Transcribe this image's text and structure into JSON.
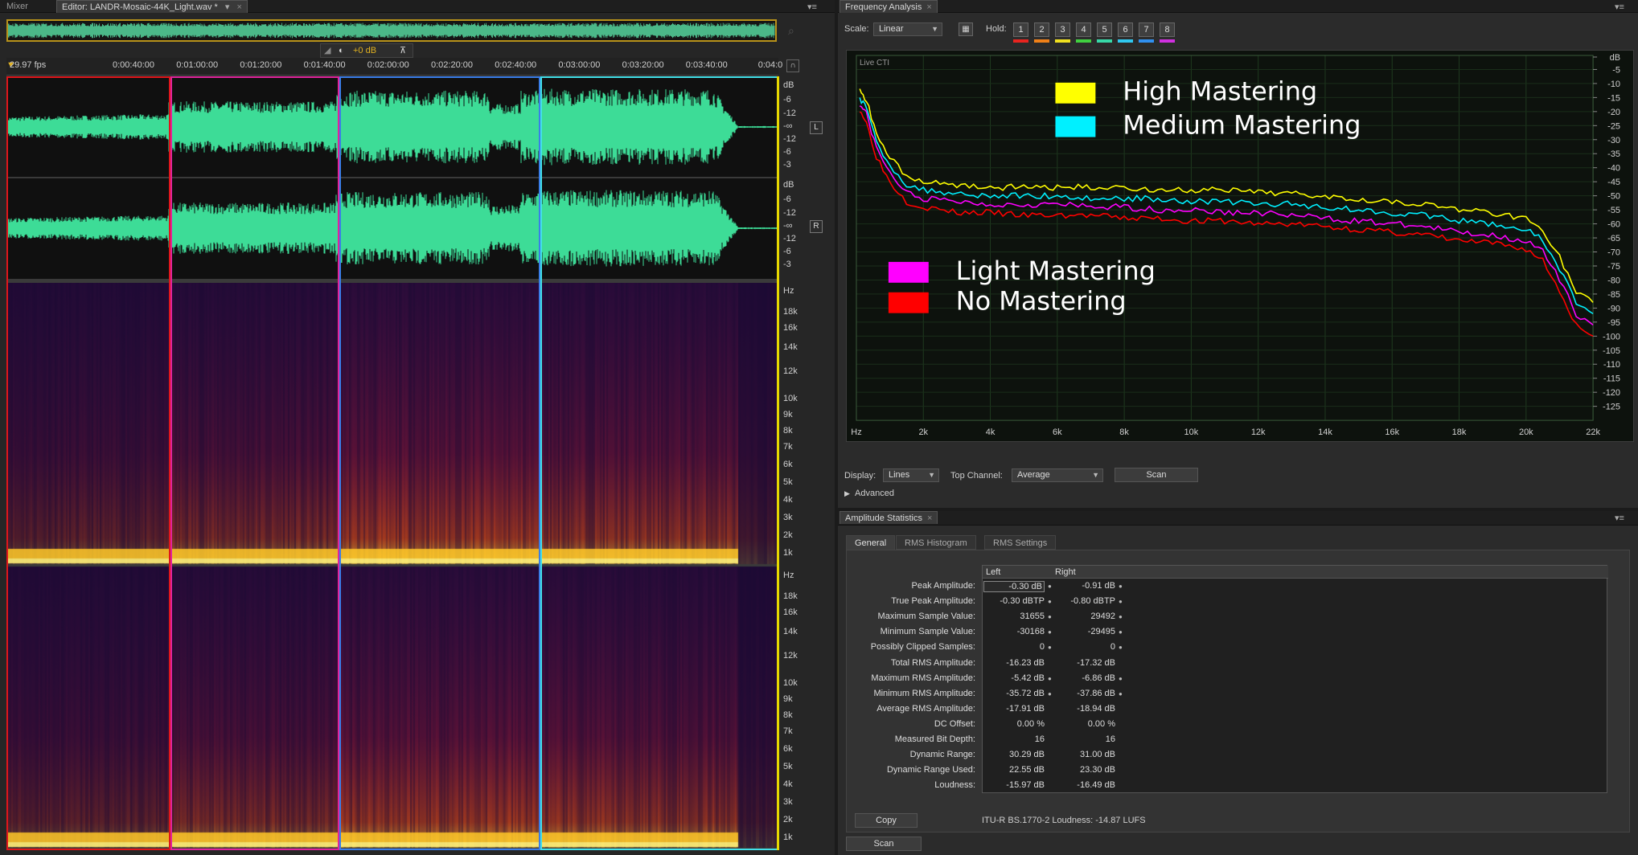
{
  "editor": {
    "tabs": [
      {
        "label": "Mixer"
      },
      {
        "label": "Editor: LANDR-Mosaic-44K_Light.wav *"
      }
    ],
    "fps_label": "29.97 fps",
    "hud_gain": "+0 dB",
    "timeline_ticks": [
      "0:00:40:00",
      "0:01:00:00",
      "0:01:20:00",
      "0:01:40:00",
      "0:02:00:00",
      "0:02:20:00",
      "0:02:40:00",
      "0:03:00:00",
      "0:03:20:00",
      "0:03:40:00",
      "0:04:0"
    ],
    "waveform_scale": [
      "dB",
      "-6",
      "-12",
      "-∞",
      "-12",
      "-6",
      "-3"
    ],
    "channels": [
      "L",
      "R"
    ],
    "spectral_scale": [
      "Hz",
      "18k",
      "16k",
      "14k",
      "12k",
      "10k",
      "9k",
      "8k",
      "7k",
      "6k",
      "5k",
      "4k",
      "3k",
      "2k",
      "1k"
    ],
    "selection_colors": {
      "red": "#e0161b",
      "magenta": "#e0249c",
      "blue": "#3a7de8",
      "cyan": "#42e0e8",
      "yellow": "#e8d800"
    },
    "waveform_color": "#3ddc97"
  },
  "frequency_analysis": {
    "title": "Frequency Analysis",
    "scale_label": "Scale:",
    "scale_value": "Linear",
    "hold_label": "Hold:",
    "hold_buttons": [
      {
        "label": "1",
        "color": "#e8241f"
      },
      {
        "label": "2",
        "color": "#f08018"
      },
      {
        "label": "3",
        "color": "#f0e020"
      },
      {
        "label": "4",
        "color": "#40d040"
      },
      {
        "label": "5",
        "color": "#38d8a8"
      },
      {
        "label": "6",
        "color": "#30c8f0"
      },
      {
        "label": "7",
        "color": "#3090f0"
      },
      {
        "label": "8",
        "color": "#d030e0"
      }
    ],
    "plot_tag": "Live CTI",
    "legend": [
      {
        "label": "High Mastering",
        "color": "#ffff00"
      },
      {
        "label": "Medium Mastering",
        "color": "#00f0ff"
      },
      {
        "label": "Light Mastering",
        "color": "#ff00ff"
      },
      {
        "label": "No Mastering",
        "color": "#ff0000"
      }
    ],
    "display_label": "Display:",
    "display_value": "Lines",
    "top_channel_label": "Top Channel:",
    "top_channel_value": "Average",
    "scan_label": "Scan",
    "advanced_label": "Advanced",
    "chart_data": {
      "type": "line",
      "xlabel": "Hz",
      "xlim": [
        0,
        22000
      ],
      "ylim": [
        -130,
        0
      ],
      "x_ticks": [
        "Hz",
        "2k",
        "4k",
        "6k",
        "8k",
        "10k",
        "12k",
        "14k",
        "16k",
        "18k",
        "20k",
        "22k"
      ],
      "y_ticks": [
        "dB",
        "-5",
        "-10",
        "-15",
        "-20",
        "-25",
        "-30",
        "-35",
        "-40",
        "-45",
        "-50",
        "-55",
        "-60",
        "-65",
        "-70",
        "-75",
        "-80",
        "-85",
        "-90",
        "-95",
        "-100",
        "-105",
        "-110",
        "-115",
        "-120",
        "-125"
      ],
      "x": [
        100,
        300,
        600,
        1000,
        1500,
        2000,
        3000,
        4000,
        5000,
        6000,
        7000,
        8000,
        9000,
        10000,
        11000,
        12000,
        13000,
        14000,
        15000,
        16000,
        17000,
        18000,
        19000,
        20000,
        20500,
        21000,
        21500,
        22000
      ],
      "series": [
        {
          "name": "High Mastering",
          "color": "#ffff00",
          "values": [
            -12,
            -16,
            -28,
            -36,
            -43,
            -45,
            -46,
            -47,
            -47,
            -47,
            -47,
            -47,
            -48,
            -48,
            -48,
            -49,
            -49,
            -50,
            -51,
            -52,
            -53,
            -55,
            -56,
            -58,
            -62,
            -72,
            -84,
            -88
          ]
        },
        {
          "name": "Medium Mastering",
          "color": "#00f0ff",
          "values": [
            -15,
            -19,
            -31,
            -39,
            -46,
            -48,
            -49,
            -50,
            -50,
            -50,
            -51,
            -51,
            -51,
            -52,
            -52,
            -53,
            -53,
            -54,
            -55,
            -56,
            -57,
            -59,
            -60,
            -62,
            -66,
            -76,
            -88,
            -92
          ]
        },
        {
          "name": "Light Mastering",
          "color": "#ff00ff",
          "values": [
            -17,
            -21,
            -33,
            -42,
            -49,
            -51,
            -52,
            -53,
            -53,
            -53,
            -54,
            -54,
            -55,
            -55,
            -56,
            -56,
            -57,
            -58,
            -59,
            -60,
            -61,
            -63,
            -64,
            -66,
            -70,
            -80,
            -92,
            -96
          ]
        },
        {
          "name": "No Mastering",
          "color": "#ff0000",
          "values": [
            -19,
            -24,
            -36,
            -45,
            -52,
            -54,
            -56,
            -56,
            -57,
            -57,
            -57,
            -58,
            -58,
            -59,
            -59,
            -60,
            -60,
            -61,
            -62,
            -63,
            -64,
            -66,
            -67,
            -69,
            -73,
            -84,
            -96,
            -100
          ]
        }
      ]
    }
  },
  "amplitude_statistics": {
    "title": "Amplitude Statistics",
    "tabs": [
      "General",
      "RMS Histogram",
      "RMS Settings"
    ],
    "columns": [
      "Left",
      "Right"
    ],
    "rows": [
      {
        "label": "Peak Amplitude:",
        "left": "-0.30 dB",
        "right": "-0.91 dB",
        "pin": true
      },
      {
        "label": "True Peak Amplitude:",
        "left": "-0.30 dBTP",
        "right": "-0.80 dBTP",
        "pin": true
      },
      {
        "label": "Maximum Sample Value:",
        "left": "31655",
        "right": "29492",
        "pin": true
      },
      {
        "label": "Minimum Sample Value:",
        "left": "-30168",
        "right": "-29495",
        "pin": true
      },
      {
        "label": "Possibly Clipped Samples:",
        "left": "0",
        "right": "0",
        "pin": true
      },
      {
        "label": "Total RMS Amplitude:",
        "left": "-16.23 dB",
        "right": "-17.32 dB",
        "pin": false
      },
      {
        "label": "Maximum RMS Amplitude:",
        "left": "-5.42 dB",
        "right": "-6.86 dB",
        "pin": true
      },
      {
        "label": "Minimum RMS Amplitude:",
        "left": "-35.72 dB",
        "right": "-37.86 dB",
        "pin": true
      },
      {
        "label": "Average RMS Amplitude:",
        "left": "-17.91 dB",
        "right": "-18.94 dB",
        "pin": false
      },
      {
        "label": "DC Offset:",
        "left": "0.00 %",
        "right": "0.00 %",
        "pin": false
      },
      {
        "label": "Measured Bit Depth:",
        "left": "16",
        "right": "16",
        "pin": false
      },
      {
        "label": "Dynamic Range:",
        "left": "30.29 dB",
        "right": "31.00 dB",
        "pin": false
      },
      {
        "label": "Dynamic Range Used:",
        "left": "22.55 dB",
        "right": "23.30 dB",
        "pin": false
      },
      {
        "label": "Loudness:",
        "left": "-15.97 dB",
        "right": "-16.49 dB",
        "pin": false
      }
    ],
    "copy_label": "Copy",
    "loudness_text": "ITU-R BS.1770-2 Loudness: -14.87 LUFS",
    "scan_label": "Scan"
  }
}
